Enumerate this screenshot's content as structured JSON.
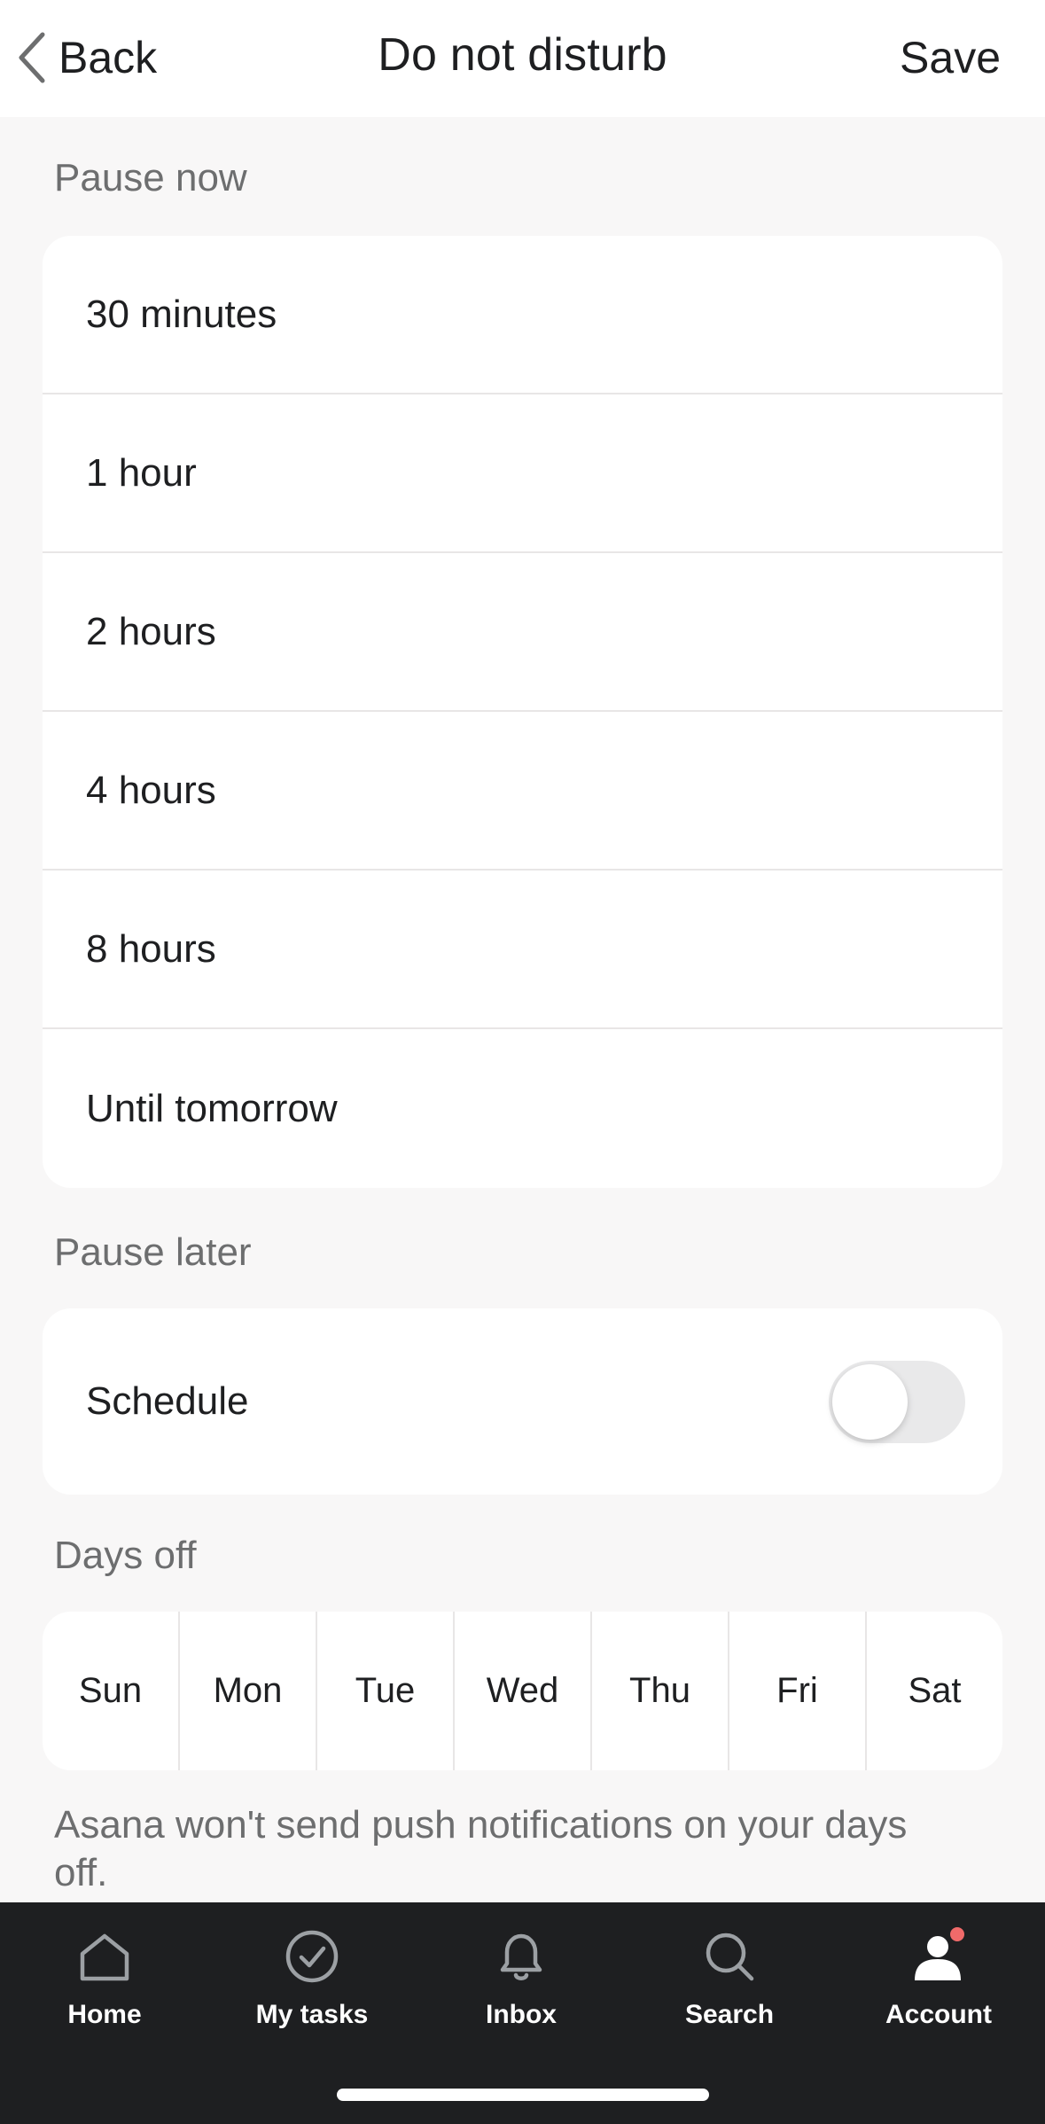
{
  "header": {
    "back_label": "Back",
    "title": "Do not disturb",
    "save_label": "Save"
  },
  "pause_now": {
    "label": "Pause now",
    "items": [
      "30 minutes",
      "1 hour",
      "2 hours",
      "4 hours",
      "8 hours",
      "Until tomorrow"
    ]
  },
  "pause_later": {
    "label": "Pause later",
    "schedule_label": "Schedule",
    "schedule_on": false
  },
  "days_off": {
    "label": "Days off",
    "days": [
      "Sun",
      "Mon",
      "Tue",
      "Wed",
      "Thu",
      "Fri",
      "Sat"
    ],
    "note": "Asana won't send push notifications on your days off."
  },
  "tabbar": {
    "tabs": [
      {
        "label": "Home",
        "icon": "home-icon"
      },
      {
        "label": "My tasks",
        "icon": "check-circle-icon"
      },
      {
        "label": "Inbox",
        "icon": "bell-icon"
      },
      {
        "label": "Search",
        "icon": "search-icon"
      },
      {
        "label": "Account",
        "icon": "account-icon"
      }
    ]
  },
  "colors": {
    "tabbar_bg": "#1e1f21",
    "badge": "#f06a6a",
    "page_bg": "#f8f7f7"
  }
}
